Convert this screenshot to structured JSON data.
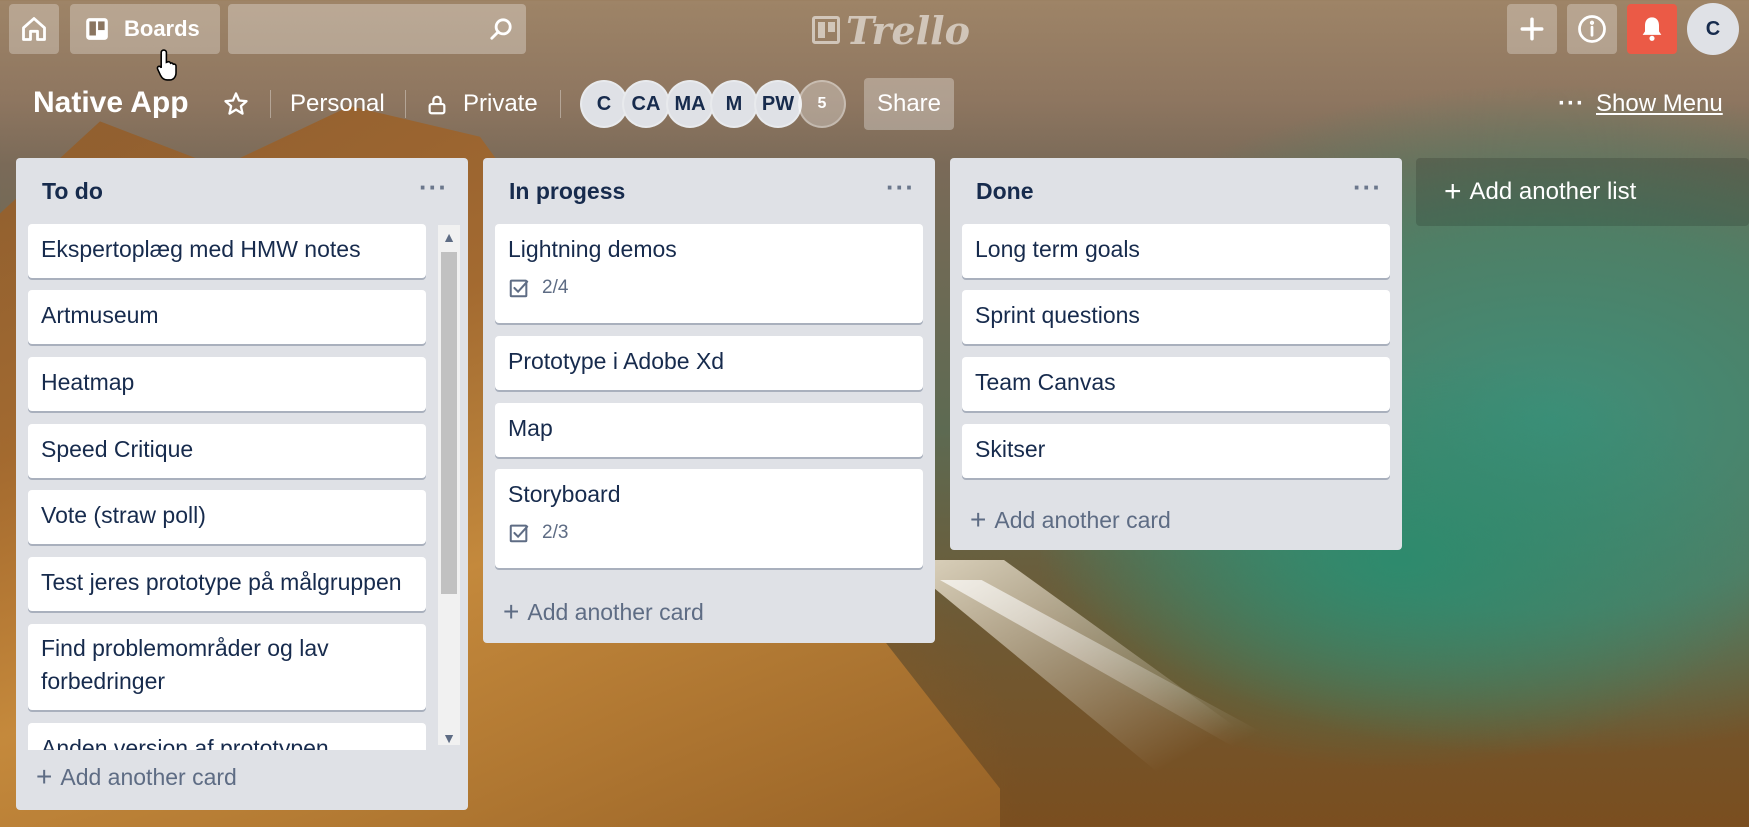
{
  "header": {
    "boards_label": "Boards",
    "search_value": "",
    "logo_text": "Trello",
    "user_initial": "C"
  },
  "board": {
    "title": "Native App",
    "team": "Personal",
    "visibility": "Private",
    "members": [
      "C",
      "CA",
      "MA",
      "M",
      "PW"
    ],
    "more_members": "5",
    "share_label": "Share",
    "show_menu_label": "Show Menu"
  },
  "lists": [
    {
      "title": "To do",
      "cards": [
        {
          "title": "Ekspertoplæg med HMW notes"
        },
        {
          "title": "Artmuseum"
        },
        {
          "title": "Heatmap"
        },
        {
          "title": "Speed Critique"
        },
        {
          "title": "Vote (straw poll)"
        },
        {
          "title": "Test jeres prototype på målgruppen"
        },
        {
          "title": "Find problemområder og lav forbedringer"
        },
        {
          "title": "Anden version af prototypen"
        }
      ],
      "add_card_label": "Add another card"
    },
    {
      "title": "In progess",
      "cards": [
        {
          "title": "Lightning demos",
          "checklist": "2/4"
        },
        {
          "title": "Prototype i Adobe Xd"
        },
        {
          "title": "Map"
        },
        {
          "title": "Storyboard",
          "checklist": "2/3"
        }
      ],
      "add_card_label": "Add another card"
    },
    {
      "title": "Done",
      "cards": [
        {
          "title": "Long term goals"
        },
        {
          "title": "Sprint questions"
        },
        {
          "title": "Team Canvas"
        },
        {
          "title": "Skitser"
        }
      ],
      "add_card_label": "Add another card"
    }
  ],
  "add_list_label": "Add another list",
  "colors": {
    "list_bg": "#dfe1e6",
    "card_text": "#172b4d",
    "notification_red": "#eb5a46"
  }
}
